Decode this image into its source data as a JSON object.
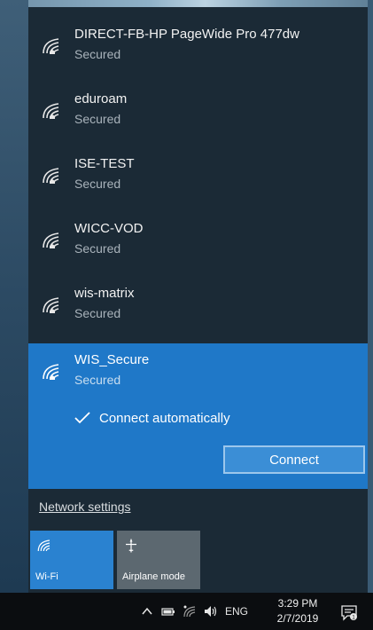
{
  "networks": [
    {
      "name": "DIRECT-FB-HP PageWide Pro 477dw",
      "status": "Secured"
    },
    {
      "name": "eduroam",
      "status": "Secured"
    },
    {
      "name": "ISE-TEST",
      "status": "Secured"
    },
    {
      "name": "WICC-VOD",
      "status": "Secured"
    },
    {
      "name": "wis-matrix",
      "status": "Secured"
    }
  ],
  "selected_network": {
    "name": "WIS_Secure",
    "status": "Secured",
    "connect_automatically_label": "Connect automatically",
    "connect_automatically_checked": true,
    "connect_button_label": "Connect"
  },
  "network_settings_label": "Network settings",
  "quick_actions": {
    "wifi_label": "Wi-Fi",
    "wifi_icon": "wifi-icon",
    "airplane_label": "Airplane mode",
    "airplane_icon": "airplane-icon"
  },
  "taskbar": {
    "language": "ENG",
    "time": "3:29 PM",
    "date": "2/7/2019",
    "tray_icons": [
      "chevron-up-icon",
      "battery-icon",
      "wifi-icon",
      "volume-icon"
    ]
  },
  "colors": {
    "flyout_bg": "#1b2a36",
    "selected_bg": "#1f78c8",
    "wifi_tile_bg": "#2a82d0",
    "airplane_tile_bg": "#5c6870",
    "taskbar_bg": "#0b0d10"
  }
}
